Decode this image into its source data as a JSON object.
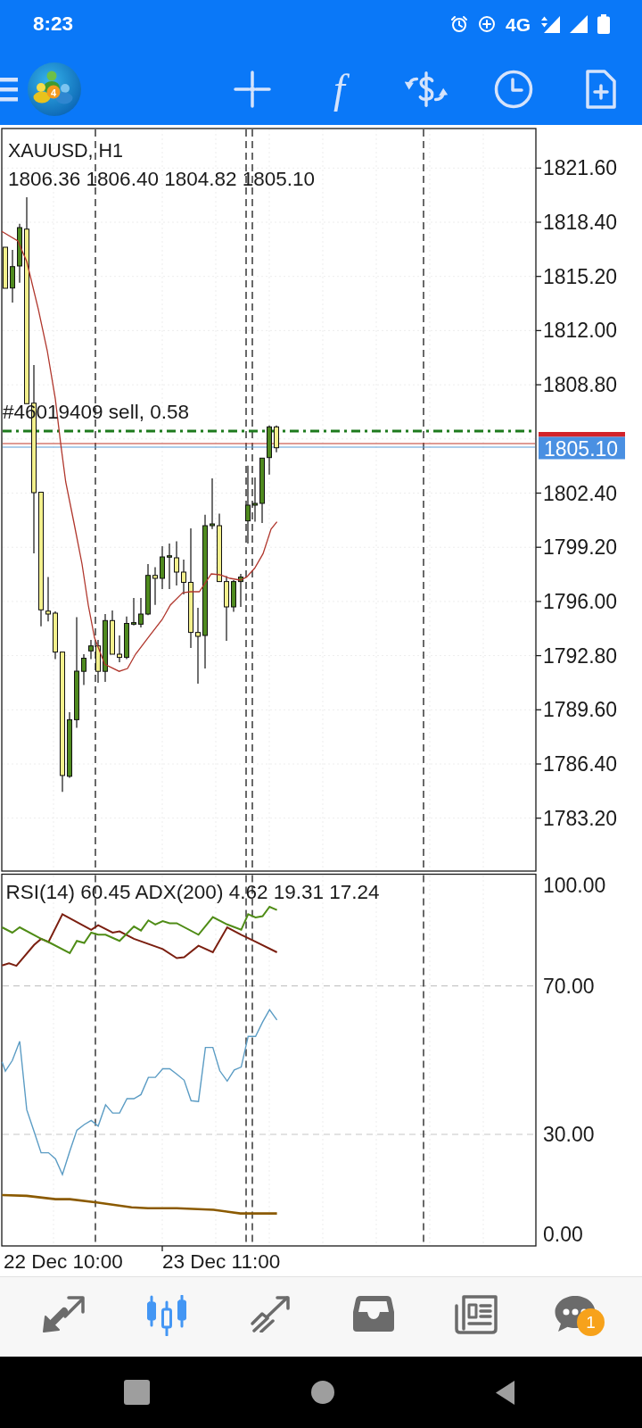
{
  "status_bar": {
    "time": "8:23",
    "network": "4G"
  },
  "toolbar": {
    "logo_mark": "4",
    "items": [
      {
        "kind": "crosshair"
      },
      {
        "kind": "function",
        "glyph": "f"
      },
      {
        "kind": "trade"
      },
      {
        "kind": "clock"
      },
      {
        "kind": "new-document"
      }
    ]
  },
  "chart": {
    "symbol": "XAUUSD, H1",
    "ohlc": "1806.36 1806.40 1804.82 1805.10",
    "order_label": "#46019409 sell, 0.58",
    "price_ticks": [
      "1821.60",
      "1818.40",
      "1815.20",
      "1812.00",
      "1808.80",
      "1802.40",
      "1799.20",
      "1796.00",
      "1792.80",
      "1789.60",
      "1786.40",
      "1783.20"
    ],
    "current_price": "1805.10"
  },
  "indicator": {
    "title": "RSI(14) 60.45 ADX(200) 4.62 19.31 17.24",
    "levels": [
      "100.00",
      "70.00",
      "30.00",
      "0.00"
    ]
  },
  "time_axis": [
    "22 Dec 10:00",
    "23 Dec 11:00"
  ],
  "bottom_nav": [
    {
      "kind": "quotes",
      "selected": false
    },
    {
      "kind": "chart",
      "selected": true
    },
    {
      "kind": "trade",
      "selected": false
    },
    {
      "kind": "history",
      "selected": false
    },
    {
      "kind": "news",
      "selected": false
    },
    {
      "kind": "chat",
      "selected": false,
      "badge": "1"
    }
  ]
}
